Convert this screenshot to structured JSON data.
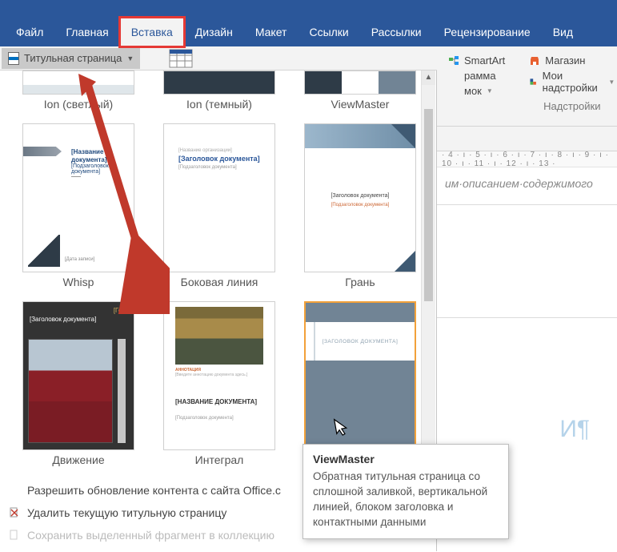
{
  "tabs": {
    "file": "Файл",
    "home": "Главная",
    "insert": "Вставка",
    "design": "Дизайн",
    "layout": "Макет",
    "references": "Ссылки",
    "mailings": "Рассылки",
    "review": "Рецензирование",
    "view": "Вид"
  },
  "cover_btn": "Титульная страница",
  "right": {
    "smartart": "SmartArt",
    "chart": "рамма",
    "screenshot": "мок",
    "store": "Магазин",
    "addins": "Мои надстройки",
    "group": "Надстройки"
  },
  "ruler": "· 4 · ı · 5 · ı · 6 · ı · 7 · ı · 8 · ı · 9 · ı · 10 · ı · 11 · ı · 12 · ı · 13 ·",
  "doc_text": "им·описанием·содержимого",
  "row1": {
    "a": "Ion (светлый)",
    "b": "Ion (темный)",
    "c": "ViewMaster"
  },
  "row2": {
    "a": {
      "label": "Whisp",
      "title": "[Название документа]",
      "sub": "[Подзаголовок документа]",
      "dec": "------",
      "footer": "[Дата записи]"
    },
    "b": {
      "label": "Боковая линия",
      "org": "[Название организации]",
      "title": "[Заголовок документа]",
      "sub": "[Подзаголовок документа]"
    },
    "c": {
      "label": "Грань",
      "title": "[Заголовок документа]",
      "sub": "[Подзаголовок документа]"
    }
  },
  "row3": {
    "a": {
      "label": "Движение",
      "year": "[Год]",
      "title": "[Заголовок документа]"
    },
    "b": {
      "label": "Интеграл",
      "abstract": "АННОТАЦИЯ",
      "desc": "[Введите аннотацию документа здесь.]",
      "title": "[НАЗВАНИЕ ДОКУМЕНТА]",
      "sub": "[Подзаголовок документа]"
    },
    "c": {
      "label": "",
      "title": "[ЗАГОЛОВОК ДОКУМЕНТА]"
    }
  },
  "menu": {
    "update": "Разрешить обновление контента с сайта Office.с",
    "remove": "Удалить текущую титульную страницу",
    "save": "Сохранить выделенный фрагмент в коллекцию"
  },
  "tooltip": {
    "title": "ViewMaster",
    "body": "Обратная титульная страница со сплошной заливкой, вертикальной линией, блоком заголовка и контактными данными"
  }
}
